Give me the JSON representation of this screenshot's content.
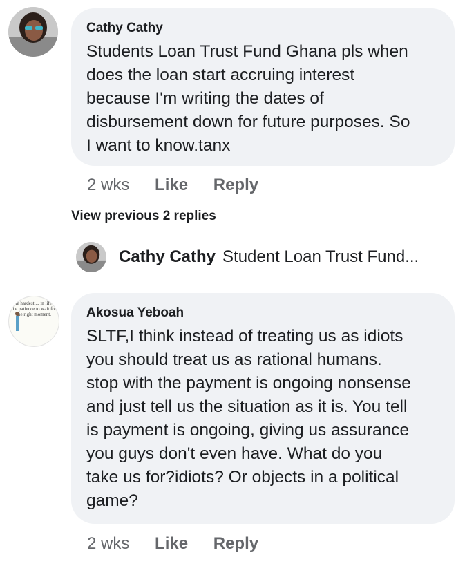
{
  "comments": [
    {
      "author": "Cathy Cathy",
      "text": "Students Loan Trust Fund Ghana pls when\ndoes the loan start accruing interest\nbecause I'm writing the dates of\ndisbursement down for future purposes. So\nI want to know.tanx",
      "time": "2 wks",
      "like_label": "Like",
      "reply_label": "Reply"
    },
    {
      "author": "Akosua Yeboah",
      "text": "SLTF,I think instead of treating us as idiots\nyou should treat us as rational humans.\nstop with the payment is ongoing nonsense\nand just tell us the situation as it is. You tell\nis payment is ongoing, giving us assurance\nyou guys don't even have. What do you\ntake us for?idiots? Or objects in a political\ngame?",
      "time": "2 wks",
      "like_label": "Like",
      "reply_label": "Reply",
      "avatar_quote": "The hardest ... in life is the patience to wait for the right moment."
    }
  ],
  "view_previous": "View previous 2 replies",
  "reply_preview": {
    "author": "Cathy Cathy",
    "text": "Student Loan Trust Fund..."
  }
}
